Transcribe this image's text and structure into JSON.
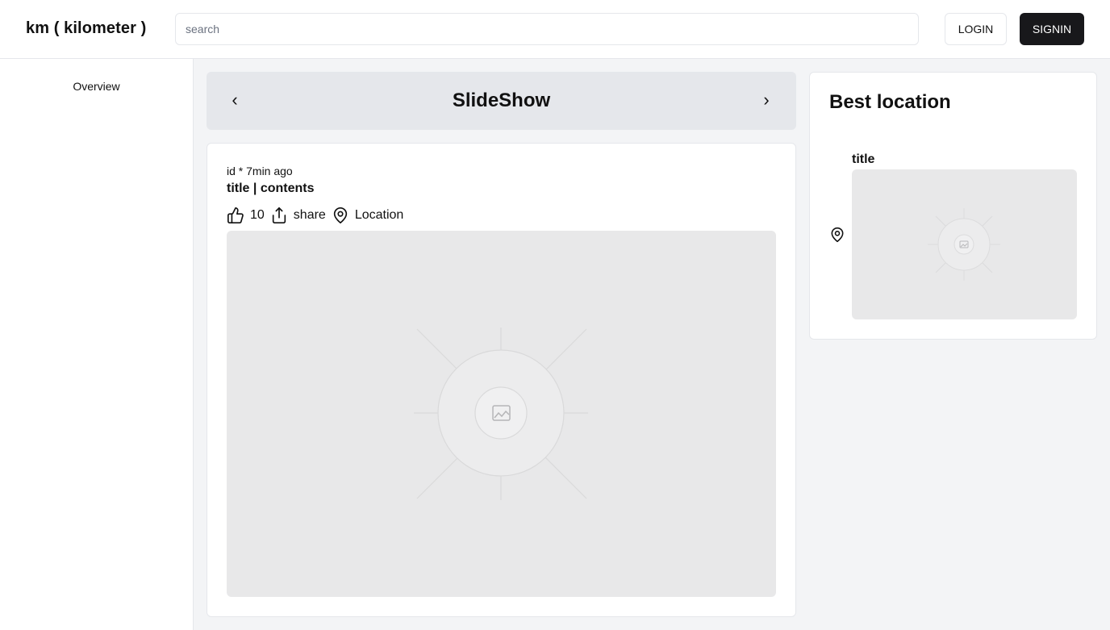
{
  "header": {
    "brand": "km ( kilometer )",
    "search_placeholder": "search",
    "login_label": "LOGIN",
    "signin_label": "SIGNIN"
  },
  "sidebar": {
    "items": [
      {
        "label": "Overview"
      }
    ]
  },
  "slideshow": {
    "title": "SlideShow",
    "prev_label": "‹",
    "next_label": "›"
  },
  "post": {
    "meta": "id * 7min ago",
    "title": "title | contents",
    "likes": "10",
    "share_label": "share",
    "location_label": "Location",
    "image": "placeholder-image"
  },
  "best_location": {
    "heading": "Best location",
    "items": [
      {
        "title": "title",
        "image": "placeholder-image"
      }
    ]
  },
  "colors": {
    "primary_button": "#18181b",
    "page_background": "#f3f4f6",
    "slideshow_background": "#e5e7eb",
    "placeholder_background": "#e8e8e9"
  },
  "icons": [
    "thumbs-up-icon",
    "share-icon",
    "map-pin-icon",
    "image-icon"
  ]
}
